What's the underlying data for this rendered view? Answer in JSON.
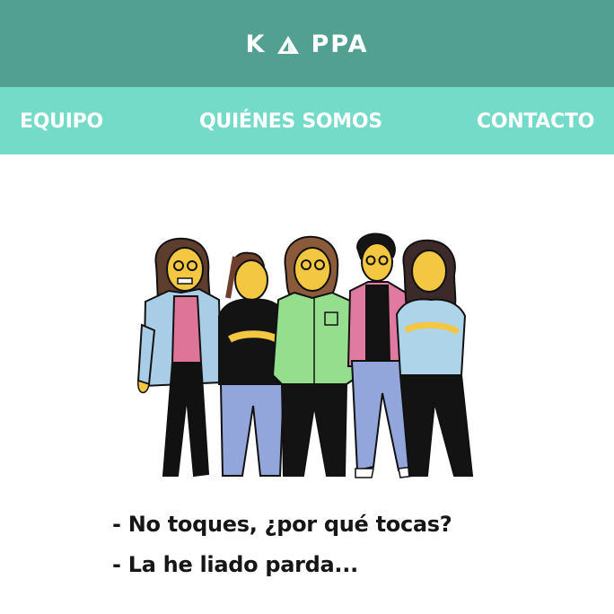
{
  "header": {
    "logo_text_left": "K",
    "logo_text_right": "PPA",
    "logo_icon": "triangle-logo-icon",
    "background": "#51a092"
  },
  "nav": {
    "background": "#74dbc8",
    "items": [
      {
        "label": "EQUIPO"
      },
      {
        "label": "QUIÉNES SOMOS"
      },
      {
        "label": "CONTACTO"
      }
    ]
  },
  "hero": {
    "image": "team-illustration"
  },
  "quote": {
    "lines": [
      "- No toques, ¿por qué tocas?",
      "- La he liado parda..."
    ]
  }
}
